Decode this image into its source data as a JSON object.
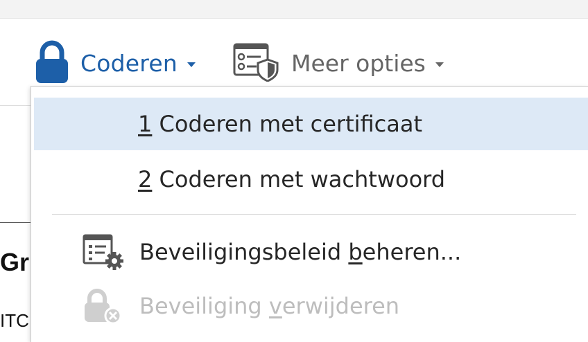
{
  "toolbar": {
    "encrypt_label": "Coderen",
    "more_options_label": "Meer opties"
  },
  "encrypt_menu": {
    "items": [
      {
        "accel": "1",
        "label": " Coderen met certificaat",
        "state": "hovered"
      },
      {
        "accel": "2",
        "label": " Coderen met wachtwoord",
        "state": "normal"
      },
      {
        "pre": "Beveiligingsbeleid ",
        "accel": "b",
        "post": "eheren...",
        "icon": "security-policy-icon",
        "state": "normal"
      },
      {
        "pre": "Beveiliging ",
        "accel": "v",
        "post": "erwijderen",
        "icon": "remove-security-icon",
        "state": "disabled"
      }
    ]
  },
  "document": {
    "heading_fragment": "Gr",
    "text_fragment": "ITC"
  },
  "colors": {
    "accent": "#1d5fa8",
    "hover_bg": "#dde9f6",
    "disabled_text": "#bdbdbd"
  }
}
